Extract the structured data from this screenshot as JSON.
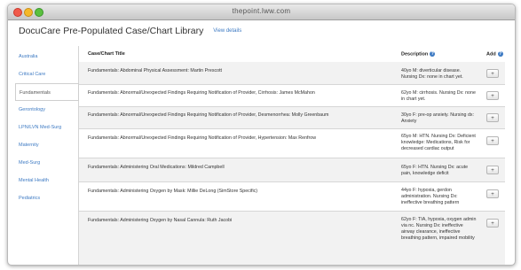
{
  "browser": {
    "url": "thepoint.lww.com"
  },
  "header": {
    "title": "DocuCare Pre-Populated Case/Chart Library",
    "details_link": "View details"
  },
  "sidebar": {
    "items": [
      {
        "label": "Australia"
      },
      {
        "label": "Critical Care"
      },
      {
        "label": "Fundamentals"
      },
      {
        "label": "Gerontology"
      },
      {
        "label": "LPN/LVN Med-Surg"
      },
      {
        "label": "Maternity"
      },
      {
        "label": "Med-Surg"
      },
      {
        "label": "Mental Health"
      },
      {
        "label": "Pediatrics"
      }
    ],
    "active": "Fundamentals"
  },
  "table": {
    "headers": {
      "title": "Case/Chart Title",
      "description": "Description",
      "add": "Add"
    },
    "help_icon": "?",
    "add_button_label": "+",
    "rows": [
      {
        "title": "Fundamentals: Abdominal Physical Assessment: Martin Prescott",
        "description": "40yo M: diverticular disease. Nursing Dx: none in chart yet."
      },
      {
        "title": "Fundamentals: Abnormal/Unexpected Findings Requiring Notification of Provider, Cirrhosis: James McMahon",
        "description": "62yo M: cirrhosis. Nursing Dx: none in chart yet."
      },
      {
        "title": "Fundamentals: Abnormal/Unexpected Findings Requiring Notification of Provider, Desmenorrhea: Molly Greenbaum",
        "description": "30yo F: pre-op anxiety. Nursing dx: Anxiety"
      },
      {
        "title": "Fundamentals: Abnormal/Unexpected Findings Requiring Notification of Provider, Hypertension: Max Renfrow",
        "description": "65yo M: HTN. Nursing Dx: Deficient knowledge: Medications, Risk for decreased cardiac output"
      },
      {
        "title": "Fundamentals: Administering Oral Medications: Mildred Campbell",
        "description": "65yo F: HTN. Nursing Dx: acute pain, knowledge deficit"
      },
      {
        "title": "Fundamentals: Administering Oxygen by Mask: Millie DeLong (SimStore Specific)",
        "description": "44yo F: hypoxia, gerdon administration. Nursing Dx: ineffective breathing pattern"
      },
      {
        "title": "Fundamentals: Administering Oxygen by Nasal Cannula: Ruth Jacobi",
        "description": "62yo F: TIA, hypoxia, oxygen admin via nc. Nursing Dx: ineffective airway clearance, ineffective breathing pattern, impaired mobility"
      }
    ]
  }
}
